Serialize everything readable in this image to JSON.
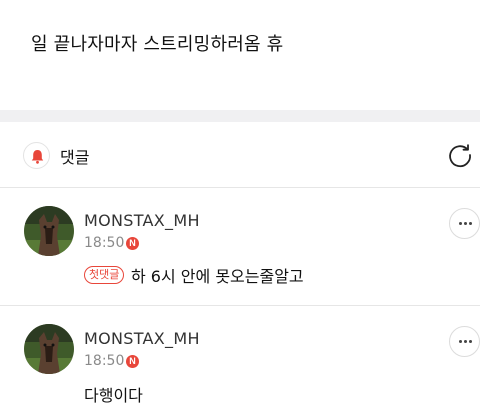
{
  "post": {
    "text": "일 끝나자마자 스트리밍하러옴 휴"
  },
  "comments_header": {
    "label": "댓글",
    "bell_icon": "bell-icon",
    "refresh_icon": "refresh-icon"
  },
  "comments": [
    {
      "username": "MONSTAX_MH",
      "time": "18:50",
      "new_badge": "N",
      "first_comment_badge": "첫댓글",
      "text": "하 6시 안에 못오는줄알고"
    },
    {
      "username": "MONSTAX_MH",
      "time": "18:50",
      "new_badge": "N",
      "text": "다행이다"
    }
  ],
  "colors": {
    "accent": "#e8463a",
    "separator": "#f0f0f2"
  }
}
